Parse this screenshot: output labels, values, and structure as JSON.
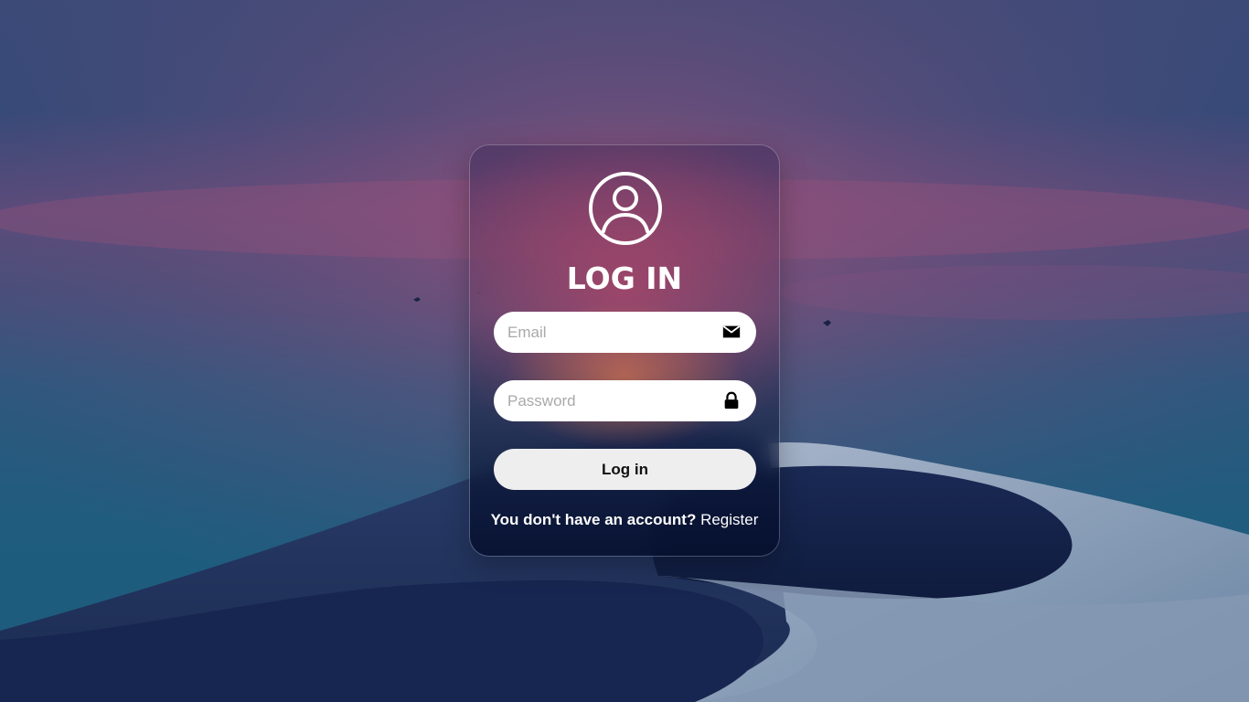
{
  "login": {
    "title": "LOG IN",
    "email_placeholder": "Email",
    "password_placeholder": "Password",
    "submit_label": "Log in",
    "register_prompt": "You don't have an account?",
    "register_link": "Register"
  },
  "icons": {
    "avatar": "user-circle-icon",
    "email": "envelope-icon",
    "password": "lock-icon"
  },
  "colors": {
    "input_background": "#ffffff",
    "button_background": "#eeeeee",
    "text_on_card": "#ffffff"
  }
}
